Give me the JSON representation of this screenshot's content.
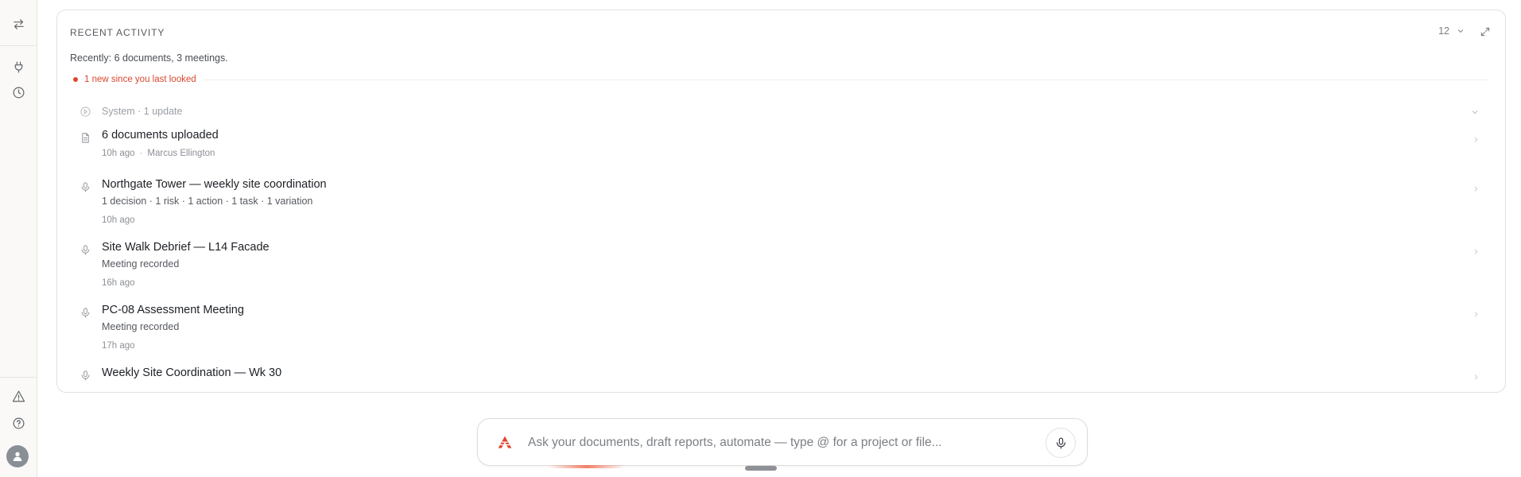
{
  "activity": {
    "title": "RECENT ACTIVITY",
    "summary": "Recently: 6 documents, 3 meetings.",
    "count": "12",
    "new_marker": "1 new since you last looked",
    "system_row": "System · 1 update",
    "items": [
      {
        "title": "6 documents uploaded",
        "time": "10h ago",
        "separator": "·",
        "author": "Marcus Ellington",
        "icon": "document-icon"
      },
      {
        "title": "Northgate Tower — weekly site coordination",
        "sub": "1 decision · 1 risk · 1 action · 1 task · 1 variation",
        "time": "10h ago",
        "icon": "microphone-icon"
      },
      {
        "title": "Site Walk Debrief — L14 Facade",
        "sub": "Meeting recorded",
        "time": "16h ago",
        "icon": "microphone-icon"
      },
      {
        "title": "PC-08 Assessment Meeting",
        "sub": "Meeting recorded",
        "time": "17h ago",
        "icon": "microphone-icon"
      },
      {
        "title": "Weekly Site Coordination — Wk 30",
        "icon": "microphone-icon"
      }
    ]
  },
  "composer": {
    "placeholder": "Ask your documents, draft reports, automate — type @ for a project or file..."
  },
  "colors": {
    "accent": "#e0452d",
    "border": "#e3e1dd",
    "rail_bg": "#faf9f7"
  }
}
